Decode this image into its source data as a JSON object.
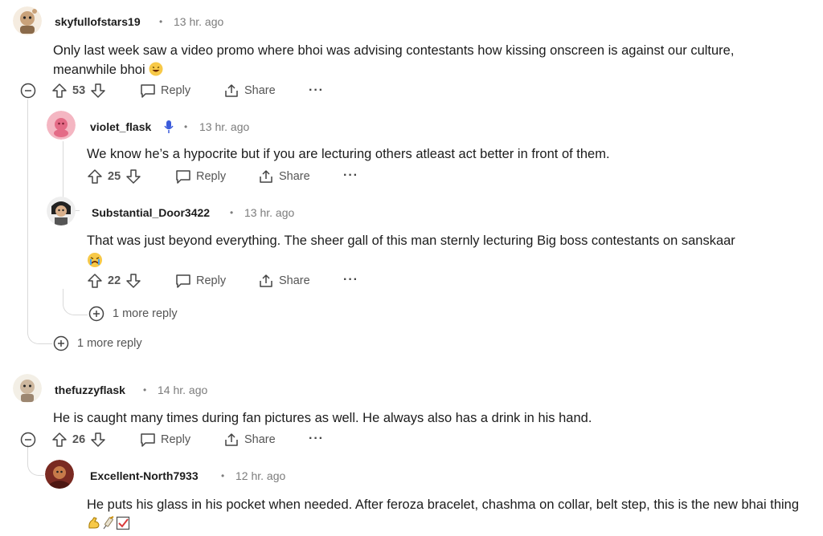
{
  "comments": [
    {
      "username": "skyfullofstars19",
      "time": "13 hr. ago",
      "text": "Only last week saw a video promo where bhoi was advising contestants how kissing onscreen is against our culture, meanwhile bhoi",
      "votes": "53",
      "reply": "Reply",
      "share": "Share"
    },
    {
      "username": "violet_flask",
      "time": "13 hr. ago",
      "text": "We know he’s a hypocrite but if you are lecturing others atleast act better in front of them.",
      "votes": "25",
      "reply": "Reply",
      "share": "Share"
    },
    {
      "username": "Substantial_Door3422",
      "time": "13 hr. ago",
      "text": "That was just beyond everything. The sheer gall of this man sternly lecturing Big boss contestants on sanskaar",
      "votes": "22",
      "reply": "Reply",
      "share": "Share"
    },
    {
      "username": "thefuzzyflask",
      "time": "14 hr. ago",
      "text": "He is caught many times during fan pictures as well. He always also has a drink in his hand.",
      "votes": "26",
      "reply": "Reply",
      "share": "Share"
    },
    {
      "username": "Excellent-North7933",
      "time": "12 hr. ago",
      "text": "He puts his glass in his pocket when needed. After feroza bracelet, chashma on collar, belt step, this is the new bhai thing"
    }
  ],
  "more_replies": [
    "1 more reply",
    "1 more reply"
  ],
  "icons": {
    "upvote": "arrow-up-icon",
    "downvote": "arrow-down-icon",
    "reply": "speech-bubble-icon",
    "share": "share-icon",
    "more": "ellipsis-icon",
    "collapse": "minus-circle-icon",
    "expand": "plus-circle-icon",
    "mic": "microphone-icon"
  },
  "colors": {
    "text": "#1c1c1c",
    "muted": "#7c7c7c",
    "thread_line": "#d9d9d9",
    "mic_blue": "#3b5bdb"
  }
}
